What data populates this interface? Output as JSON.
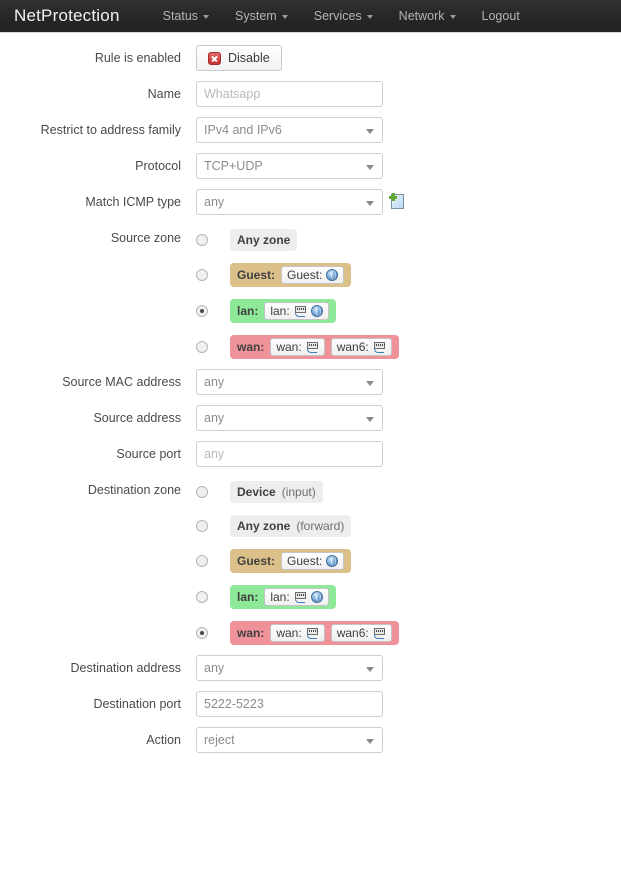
{
  "header": {
    "brand": "NetProtection",
    "nav": [
      {
        "label": "Status",
        "has_caret": true,
        "name": "nav-item-status"
      },
      {
        "label": "System",
        "has_caret": true,
        "name": "nav-item-system"
      },
      {
        "label": "Services",
        "has_caret": true,
        "name": "nav-item-services"
      },
      {
        "label": "Network",
        "has_caret": true,
        "name": "nav-item-network"
      },
      {
        "label": "Logout",
        "has_caret": false,
        "name": "nav-item-logout"
      }
    ]
  },
  "form": {
    "rule_enabled": {
      "label": "Rule is enabled",
      "button_label": "Disable",
      "icon": "deny-icon"
    },
    "name": {
      "label": "Name",
      "value": "Whatsapp",
      "placeholder": "Whatsapp"
    },
    "address_family": {
      "label": "Restrict to address family",
      "value": "IPv4 and IPv6"
    },
    "protocol": {
      "label": "Protocol",
      "value": "TCP+UDP"
    },
    "icmp_type": {
      "label": "Match ICMP type",
      "value": "any",
      "add_icon": "add-page-icon"
    },
    "source_zone": {
      "label": "Source zone",
      "options": [
        {
          "name": "Any zone",
          "sub": "",
          "style": "grey",
          "selected": false,
          "chips": []
        },
        {
          "name": "Guest:",
          "sub": "",
          "style": "guest",
          "selected": false,
          "chips": [
            {
              "label": "Guest:",
              "icons": [
                "globe-icon"
              ]
            }
          ]
        },
        {
          "name": "lan:",
          "sub": "",
          "style": "lan",
          "selected": true,
          "chips": [
            {
              "label": "lan:",
              "icons": [
                "ethernet-icon",
                "globe-icon"
              ]
            }
          ]
        },
        {
          "name": "wan:",
          "sub": "",
          "style": "wan",
          "selected": false,
          "chips": [
            {
              "label": "wan:",
              "icons": [
                "ethernet-icon"
              ]
            },
            {
              "label": "wan6:",
              "icons": [
                "ethernet-icon"
              ]
            }
          ]
        }
      ]
    },
    "source_mac": {
      "label": "Source MAC address",
      "value": "any"
    },
    "source_address": {
      "label": "Source address",
      "value": "any"
    },
    "source_port": {
      "label": "Source port",
      "value": "",
      "placeholder": "any"
    },
    "destination_zone": {
      "label": "Destination zone",
      "options": [
        {
          "name": "Device",
          "sub": "(input)",
          "style": "grey",
          "selected": false,
          "chips": []
        },
        {
          "name": "Any zone",
          "sub": "(forward)",
          "style": "grey",
          "selected": false,
          "chips": []
        },
        {
          "name": "Guest:",
          "sub": "",
          "style": "guest",
          "selected": false,
          "chips": [
            {
              "label": "Guest:",
              "icons": [
                "globe-icon"
              ]
            }
          ]
        },
        {
          "name": "lan:",
          "sub": "",
          "style": "lan",
          "selected": false,
          "chips": [
            {
              "label": "lan:",
              "icons": [
                "ethernet-icon",
                "globe-icon"
              ]
            }
          ]
        },
        {
          "name": "wan:",
          "sub": "",
          "style": "wan",
          "selected": true,
          "chips": [
            {
              "label": "wan:",
              "icons": [
                "ethernet-icon"
              ]
            },
            {
              "label": "wan6:",
              "icons": [
                "ethernet-icon"
              ]
            }
          ]
        }
      ]
    },
    "destination_address": {
      "label": "Destination address",
      "value": "any"
    },
    "destination_port": {
      "label": "Destination port",
      "value": "5222-5223",
      "placeholder": ""
    },
    "action": {
      "label": "Action",
      "value": "reject"
    }
  },
  "colors": {
    "header_bg": "#262626",
    "zone_grey": "#ededed",
    "zone_guest": "#dcc08a",
    "zone_lan": "#8de897",
    "zone_wan": "#f0929a",
    "deny_red": "#c53030",
    "add_green": "#5fa832"
  }
}
